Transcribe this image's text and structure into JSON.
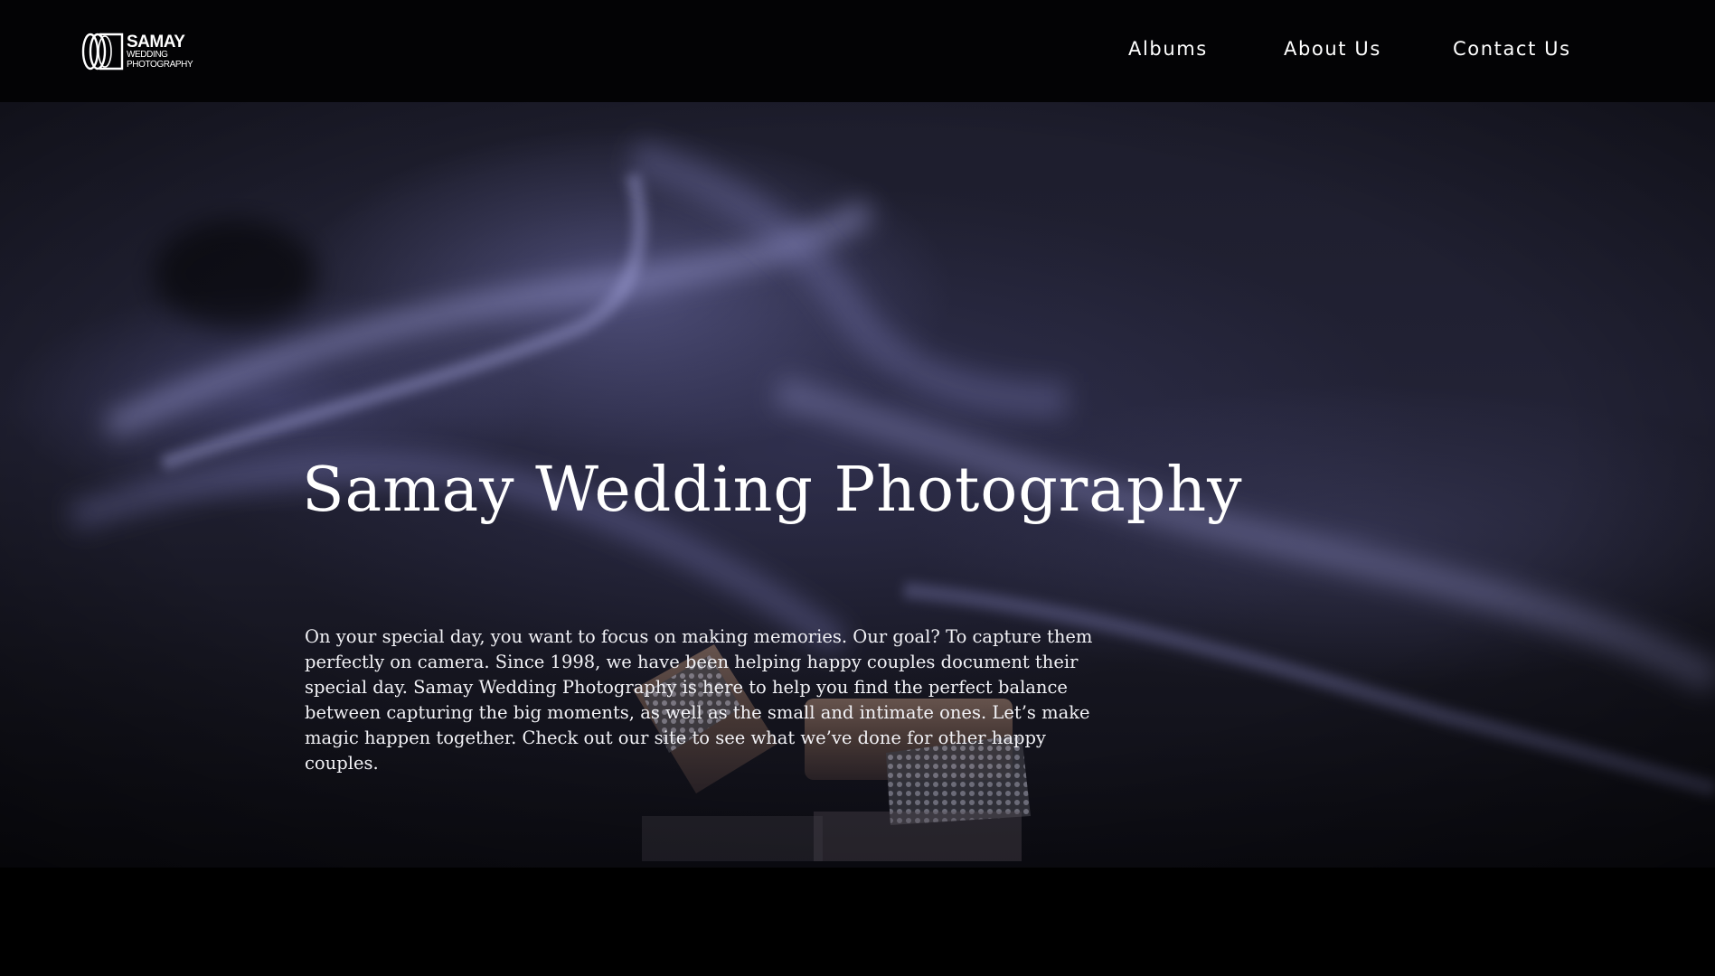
{
  "brand": {
    "logo_main": "SAMAY",
    "logo_sub_1": "WEDDING",
    "logo_sub_2": "PHOTOGRAPHY"
  },
  "nav": {
    "items": [
      {
        "label": "Albums"
      },
      {
        "label": "About Us"
      },
      {
        "label": "Contact Us"
      }
    ]
  },
  "hero": {
    "title": "Samay Wedding Photography",
    "body": "On your special day, you want to focus on making memories. Our goal? To capture them perfectly on camera. Since 1998, we have been helping happy couples document their special day. Samay Wedding Photography is here to help you find the perfect balance between capturing the big moments, as well as the small and intimate ones. Let’s make magic happen together. Check out our site to see what we’ve done for other happy couples.",
    "background_icon": "wedding-rings-smoke-photo"
  },
  "colors": {
    "header_bg": "#030305",
    "hero_tint": "#222235",
    "text": "#ffffff"
  }
}
